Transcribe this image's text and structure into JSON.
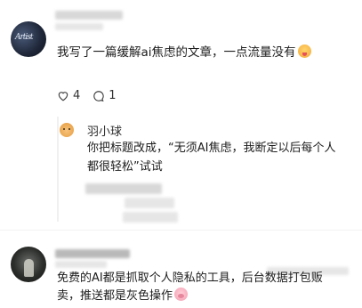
{
  "post": {
    "text": "我写了一篇缓解ai焦虑的文章，一点流量没有",
    "likes": "4",
    "comments": "1"
  },
  "reply": {
    "author": "羽小球",
    "text_line1": "你把标题改成，“无须AI焦虑，我断定以后每个人",
    "text_line2": "都很轻松”试试"
  },
  "comment2": {
    "text_line1": "免费的AI都是抓取个人隐私的工具，后台数据打包贩",
    "text_line2": "卖，推送都是灰色操作"
  },
  "icons": {
    "like": "heart-icon",
    "comment": "comment-bubble-icon",
    "emoji1": "tongue-out-emoji-icon",
    "emoji2": "pig-face-emoji-icon"
  }
}
